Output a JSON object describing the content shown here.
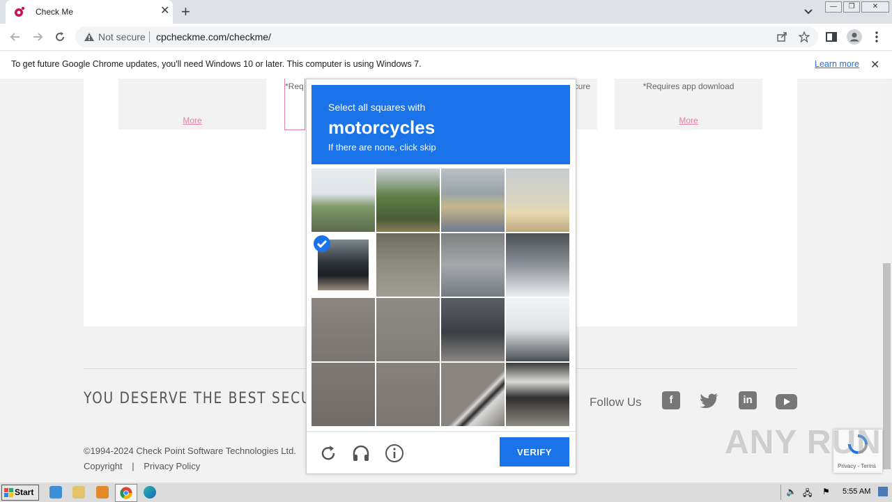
{
  "browser": {
    "tab_title": "Check Me",
    "not_secure": "Not secure",
    "url": "cpcheckme.com/checkme/"
  },
  "infobar": {
    "message": "To get future Google Chrome updates, you'll need Windows 10 or later. This computer is using Windows 7.",
    "learn_more": "Learn more"
  },
  "page": {
    "cards": [
      {
        "requirement": "",
        "more": "More"
      },
      {
        "requirement": "*Req",
        "more": ""
      },
      {
        "requirement": "cure",
        "more": ""
      },
      {
        "requirement": "*Requires app download",
        "more": "More"
      }
    ],
    "slogan": "YOU DESERVE THE BEST SECUR",
    "follow_us": "Follow Us",
    "social": [
      "facebook-icon",
      "twitter-icon",
      "linkedin-icon",
      "youtube-icon"
    ],
    "copyright": "©1994-2024 Check Point Software Technologies Ltd.",
    "links": [
      "Copyright",
      "|",
      "Privacy Policy"
    ]
  },
  "captcha": {
    "instruction": "Select all squares with",
    "keyword": "motorcycles",
    "hint": "If there are none, click skip",
    "selected_tiles": [
      4
    ],
    "verify_label": "VERIFY",
    "accent_color": "#1a73e8"
  },
  "badge": {
    "text": "Privacy - Terms"
  },
  "watermark": "ANY RUN",
  "taskbar": {
    "start_label": "Start",
    "clock": "5:55 AM"
  }
}
